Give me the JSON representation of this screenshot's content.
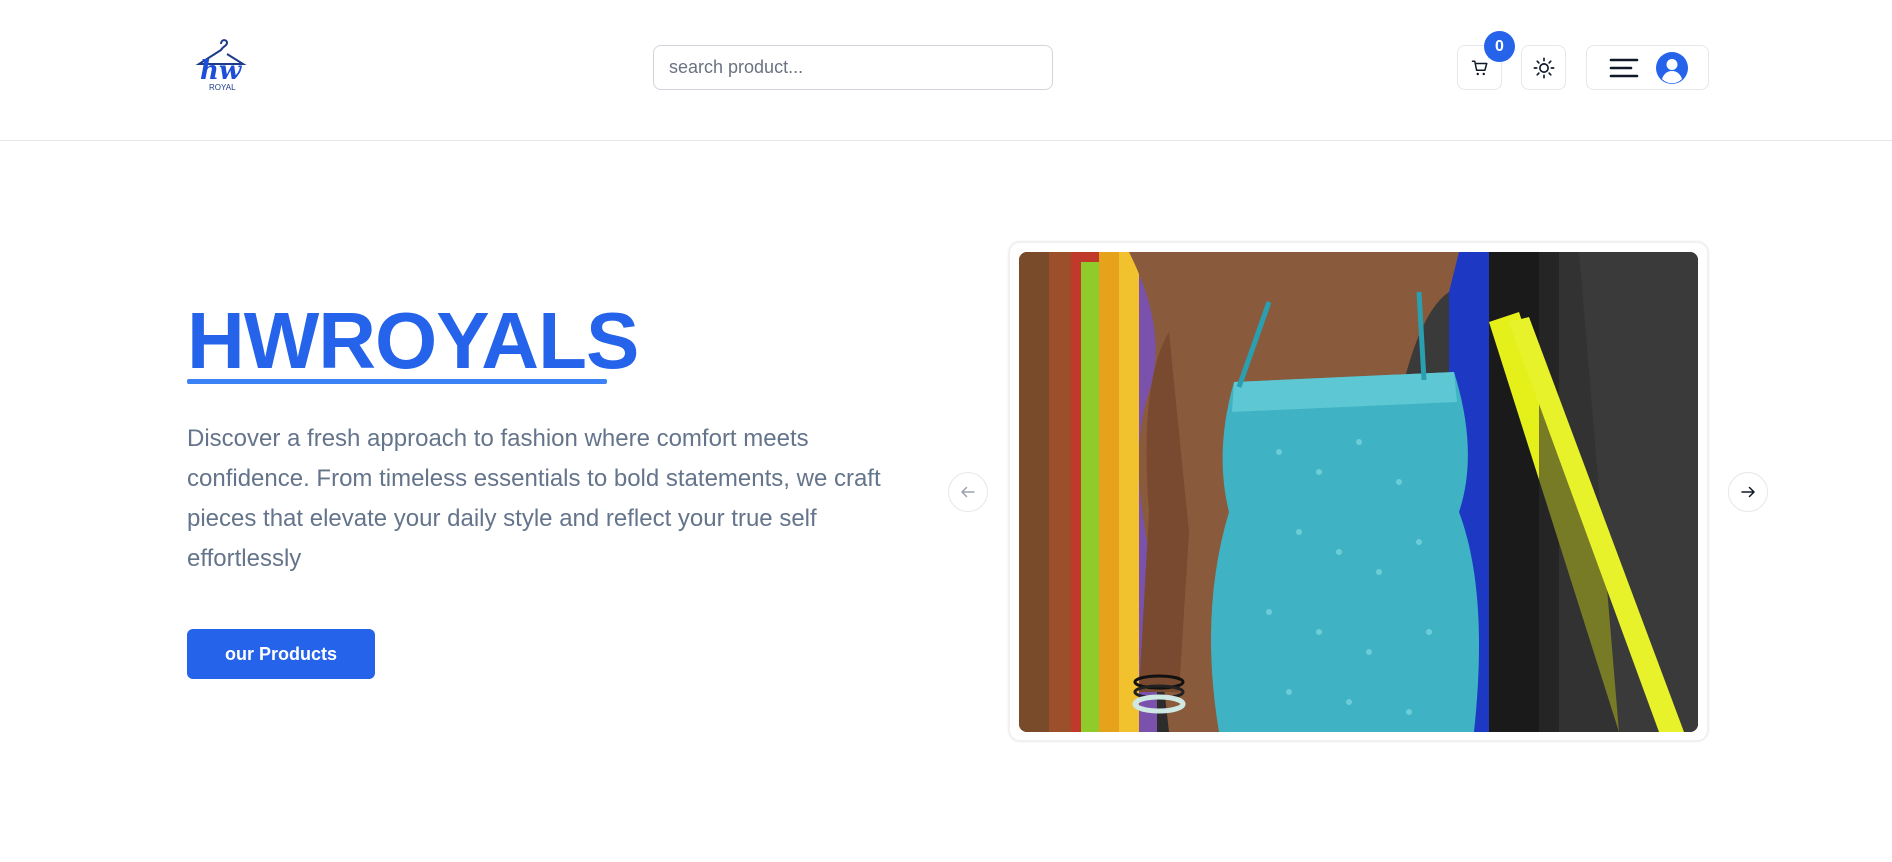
{
  "header": {
    "logo": {
      "icon": "hanger-logo-icon",
      "text": "hw",
      "subtext": "ROYAL"
    },
    "search": {
      "placeholder": "search product...",
      "value": ""
    },
    "cart": {
      "count": "0",
      "icon": "cart-icon"
    },
    "theme_toggle": {
      "icon": "sun-icon"
    },
    "menu": {
      "icon": "hamburger-icon",
      "avatar_icon": "user-avatar-icon"
    }
  },
  "hero": {
    "title": "HWROYALS",
    "description": "Discover a fresh approach to fashion where comfort meets confidence. From timeless essentials to bold statements, we craft pieces that elevate your daily style and reflect your true self effortlessly",
    "cta_label": "our Products"
  },
  "carousel": {
    "prev_icon": "arrow-left-icon",
    "next_icon": "arrow-right-icon",
    "slide_alt": "model wearing turquoise beaded dress"
  },
  "colors": {
    "accent": "#2563eb",
    "text_muted": "#64748b",
    "border": "#e5e7eb"
  }
}
